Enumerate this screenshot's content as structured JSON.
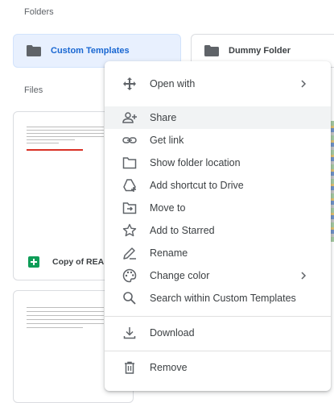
{
  "sections": {
    "folders_label": "Folders",
    "files_label": "Files"
  },
  "folders": [
    {
      "name": "Custom Templates",
      "selected": true
    },
    {
      "name": "Dummy Folder",
      "selected": false
    }
  ],
  "files": [
    {
      "title": "Copy of REA",
      "type": "sheets"
    },
    {
      "title": "",
      "type": "sheets"
    }
  ],
  "menu": {
    "items": [
      {
        "label": "Open with",
        "icon": "open-with-icon",
        "submenu": true
      },
      {
        "label": "Share",
        "icon": "share-person-add-icon",
        "hover": true
      },
      {
        "label": "Get link",
        "icon": "link-icon"
      },
      {
        "label": "Show folder location",
        "icon": "folder-outline-icon"
      },
      {
        "label": "Add shortcut to Drive",
        "icon": "add-to-drive-icon"
      },
      {
        "label": "Move to",
        "icon": "move-to-folder-icon"
      },
      {
        "label": "Add to Starred",
        "icon": "star-outline-icon"
      },
      {
        "label": "Rename",
        "icon": "pencil-icon"
      },
      {
        "label": "Change color",
        "icon": "palette-icon",
        "submenu": true
      },
      {
        "label": "Search within Custom Templates",
        "icon": "search-icon"
      },
      {
        "label": "Download",
        "icon": "download-icon"
      },
      {
        "label": "Remove",
        "icon": "trash-icon"
      }
    ]
  },
  "colors": {
    "selected_bg": "#e8f0fe",
    "selected_text": "#1967d2",
    "hover_bg": "#f1f3f4",
    "sheets_green": "#0f9d58"
  }
}
